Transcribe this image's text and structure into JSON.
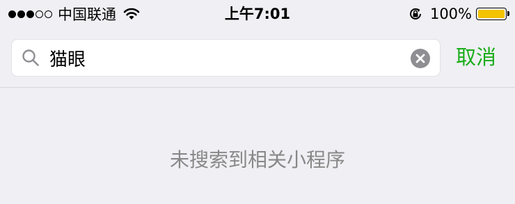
{
  "status_bar": {
    "carrier": "中国联通",
    "signal": {
      "filled": 3,
      "total": 5
    },
    "time": "上午7:01",
    "battery_percent": "100%",
    "battery_color": "#f5c400"
  },
  "search": {
    "query": "猫眼",
    "cancel_label": "取消"
  },
  "results": {
    "empty_message": "未搜索到相关小程序"
  },
  "colors": {
    "accent": "#1aad19",
    "background": "#efeff4",
    "muted_text": "#888888"
  },
  "icons": [
    "wifi-icon",
    "rotation-lock-icon",
    "battery-icon",
    "search-icon",
    "clear-icon"
  ]
}
